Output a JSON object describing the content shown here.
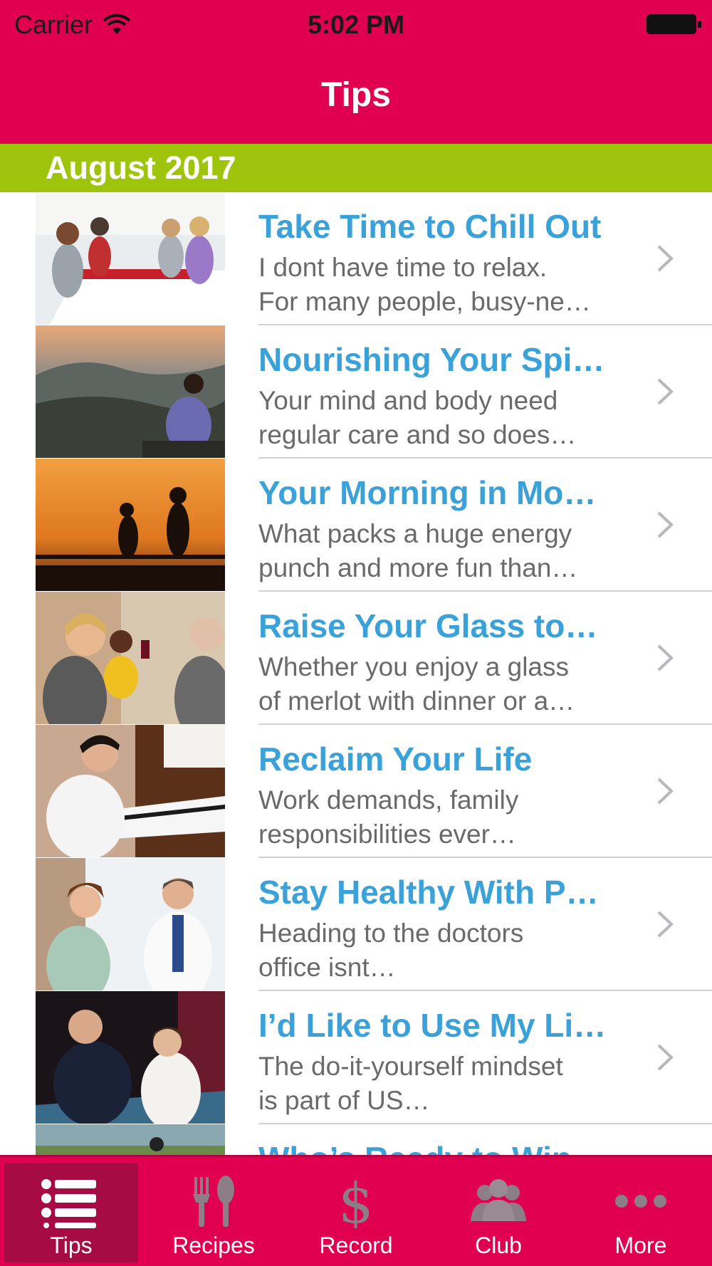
{
  "status_bar": {
    "carrier": "Carrier",
    "time": "5:02 PM"
  },
  "nav": {
    "title": "Tips"
  },
  "section": {
    "title": "August 2017"
  },
  "colors": {
    "brand": "#e0004f",
    "section": "#9ec40c",
    "title_link": "#3aa2d8"
  },
  "tips": [
    {
      "title": "Take Time to Chill Out",
      "line1": "I dont have time to relax.",
      "line2": "For many people, busy-ne…"
    },
    {
      "title": "Nourishing Your Spi…",
      "line1": "Your mind and body need",
      "line2": "regular care  and so does…"
    },
    {
      "title": "Your Morning in Mo…",
      "line1": "What packs a huge energy",
      "line2": "punch and more fun than…"
    },
    {
      "title": "Raise Your Glass to…",
      "line1": "Whether you enjoy a glass",
      "line2": "of merlot with dinner or a…"
    },
    {
      "title": "Reclaim Your Life",
      "line1": "Work demands, family",
      "line2": "responsibilities ever…"
    },
    {
      "title": "Stay Healthy With P…",
      "line1": "Heading to the doctors",
      "line2": "office isnt…"
    },
    {
      "title": "I’d Like to Use My Li…",
      "line1": "The do-it-yourself mindset",
      "line2": "is part of US…"
    },
    {
      "title": "Who’s Ready to Win…",
      "line1": "",
      "line2": ""
    }
  ],
  "tabs": [
    {
      "label": "Tips",
      "icon": "list-icon",
      "active": true
    },
    {
      "label": "Recipes",
      "icon": "fork-spoon-icon"
    },
    {
      "label": "Record",
      "icon": "dollar-icon"
    },
    {
      "label": "Club",
      "icon": "people-icon"
    },
    {
      "label": "More",
      "icon": "more-dots-icon"
    }
  ]
}
